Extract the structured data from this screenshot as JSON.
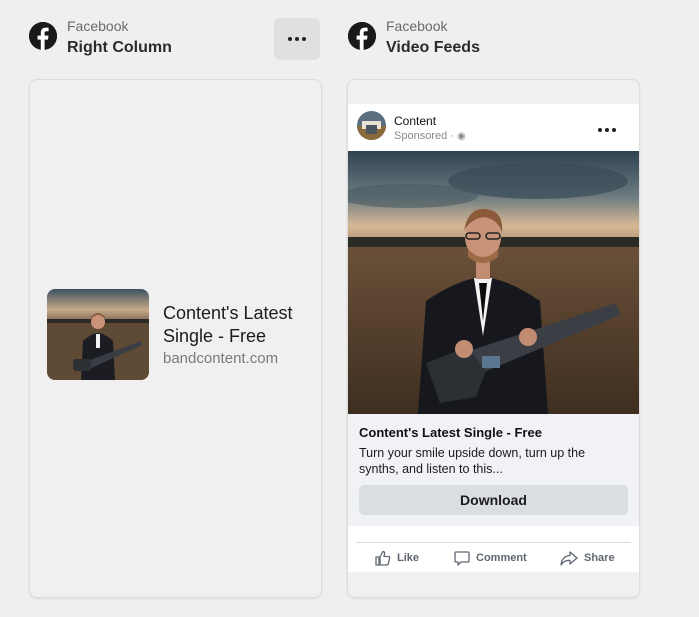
{
  "placements": [
    {
      "platform": "Facebook",
      "name": "Right Column"
    },
    {
      "platform": "Facebook",
      "name": "Video Feeds"
    }
  ],
  "right_column_ad": {
    "title": "Content's Latest Single - Free",
    "domain": "bandcontent.com"
  },
  "video_feed_ad": {
    "page_name": "Content",
    "sponsored": "Sponsored · ",
    "headline": "Content's Latest Single - Free",
    "description": "Turn your smile upside down, turn up the synths, and listen to this...",
    "cta_label": "Download",
    "actions": {
      "like": "Like",
      "comment": "Comment",
      "share": "Share"
    }
  },
  "icons": {
    "facebook": "facebook-logo-icon",
    "more": "more-dots-icon",
    "globe": "globe-icon",
    "like": "thumbs-up-icon",
    "comment": "comment-bubble-icon",
    "share": "share-arrow-icon"
  }
}
